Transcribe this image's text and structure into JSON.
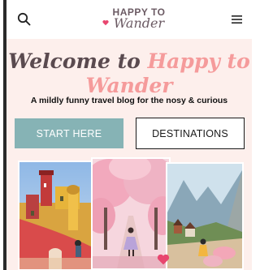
{
  "header": {
    "logo_top": "HAPPY TO",
    "logo_bottom": "Wander",
    "search_icon": "search-icon",
    "menu_icon": "hamburger-menu-icon"
  },
  "hero": {
    "title_part1": "Welcome to ",
    "title_part2": "Happy to",
    "title_line2": "Wander",
    "subtitle": "A mildly funny travel blog for the nosy & curious",
    "start_button": "START HERE",
    "destinations_button": "DESTINATIONS"
  },
  "colors": {
    "hero_background": "#fdefec",
    "accent_pink": "#f59b9b",
    "title_dark": "#5a4a4f",
    "start_button_bg": "#86b3b5"
  },
  "photos": [
    {
      "name": "palace-photo",
      "description_icon": "photo-pena-palace"
    },
    {
      "name": "cherry-blossom-photo",
      "description_icon": "photo-cherry-blossom"
    },
    {
      "name": "mountain-village-photo",
      "description_icon": "photo-mountain-valley"
    }
  ]
}
